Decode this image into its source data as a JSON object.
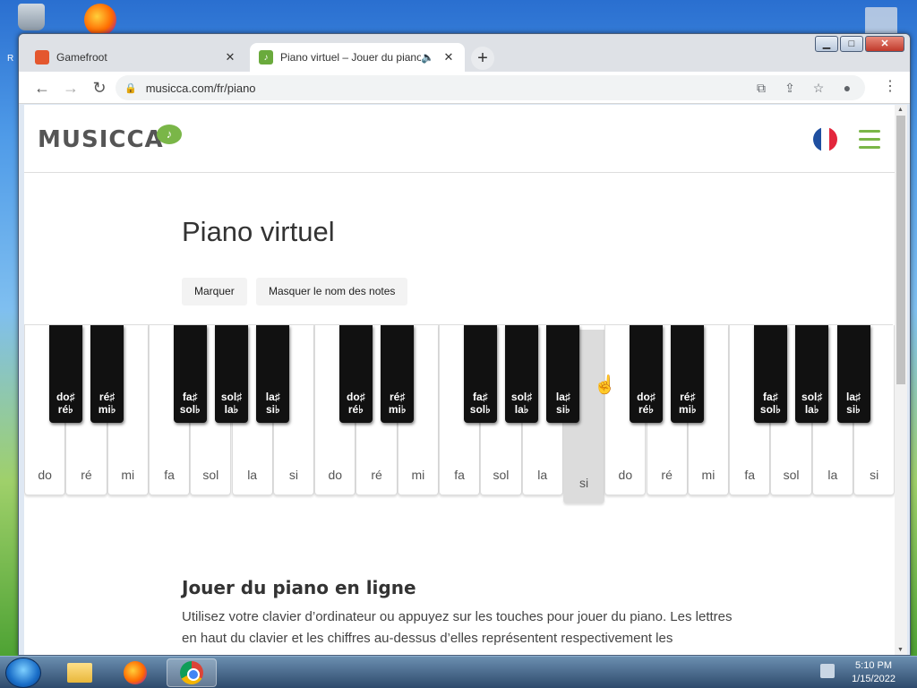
{
  "desktop": {
    "left_label": "R"
  },
  "browser": {
    "tabs": [
      {
        "title": "Gamefroot",
        "active": false
      },
      {
        "title": "Piano virtuel – Jouer du piano",
        "active": true
      }
    ],
    "url": "musicca.com/fr/piano"
  },
  "site": {
    "logo": "MUSICCA",
    "title": "Piano virtuel",
    "buttons": {
      "mark": "Marquer",
      "hide_names": "Masquer le nom des notes"
    },
    "white_keys": [
      "do",
      "ré",
      "mi",
      "fa",
      "sol",
      "la",
      "si",
      "do",
      "ré",
      "mi",
      "fa",
      "sol",
      "la",
      "si",
      "do",
      "ré",
      "mi",
      "fa",
      "sol",
      "la",
      "si"
    ],
    "pressed_white_index": 13,
    "black_keys": [
      {
        "line1": "do♯",
        "line2": "ré♭"
      },
      {
        "line1": "ré♯",
        "line2": "mi♭"
      },
      {
        "line1": "fa♯",
        "line2": "sol♭"
      },
      {
        "line1": "sol♯",
        "line2": "la♭"
      },
      {
        "line1": "la♯",
        "line2": "si♭"
      },
      {
        "line1": "do♯",
        "line2": "ré♭"
      },
      {
        "line1": "ré♯",
        "line2": "mi♭"
      },
      {
        "line1": "fa♯",
        "line2": "sol♭"
      },
      {
        "line1": "sol♯",
        "line2": "la♭"
      },
      {
        "line1": "la♯",
        "line2": "si♭"
      },
      {
        "line1": "do♯",
        "line2": "ré♭"
      },
      {
        "line1": "ré♯",
        "line2": "mi♭"
      },
      {
        "line1": "fa♯",
        "line2": "sol♭"
      },
      {
        "line1": "sol♯",
        "line2": "la♭"
      },
      {
        "line1": "la♯",
        "line2": "si♭"
      }
    ],
    "section_heading": "Jouer du piano en ligne",
    "section_text": "Utilisez votre clavier d’ordinateur ou appuyez sur les touches pour jouer du piano. Les lettres en haut du clavier et les chiffres au-dessus d’elles représentent respectivement les"
  },
  "taskbar": {
    "time": "5:10 PM",
    "date": "1/15/2022"
  },
  "colors": {
    "brand_green": "#7ab648"
  }
}
